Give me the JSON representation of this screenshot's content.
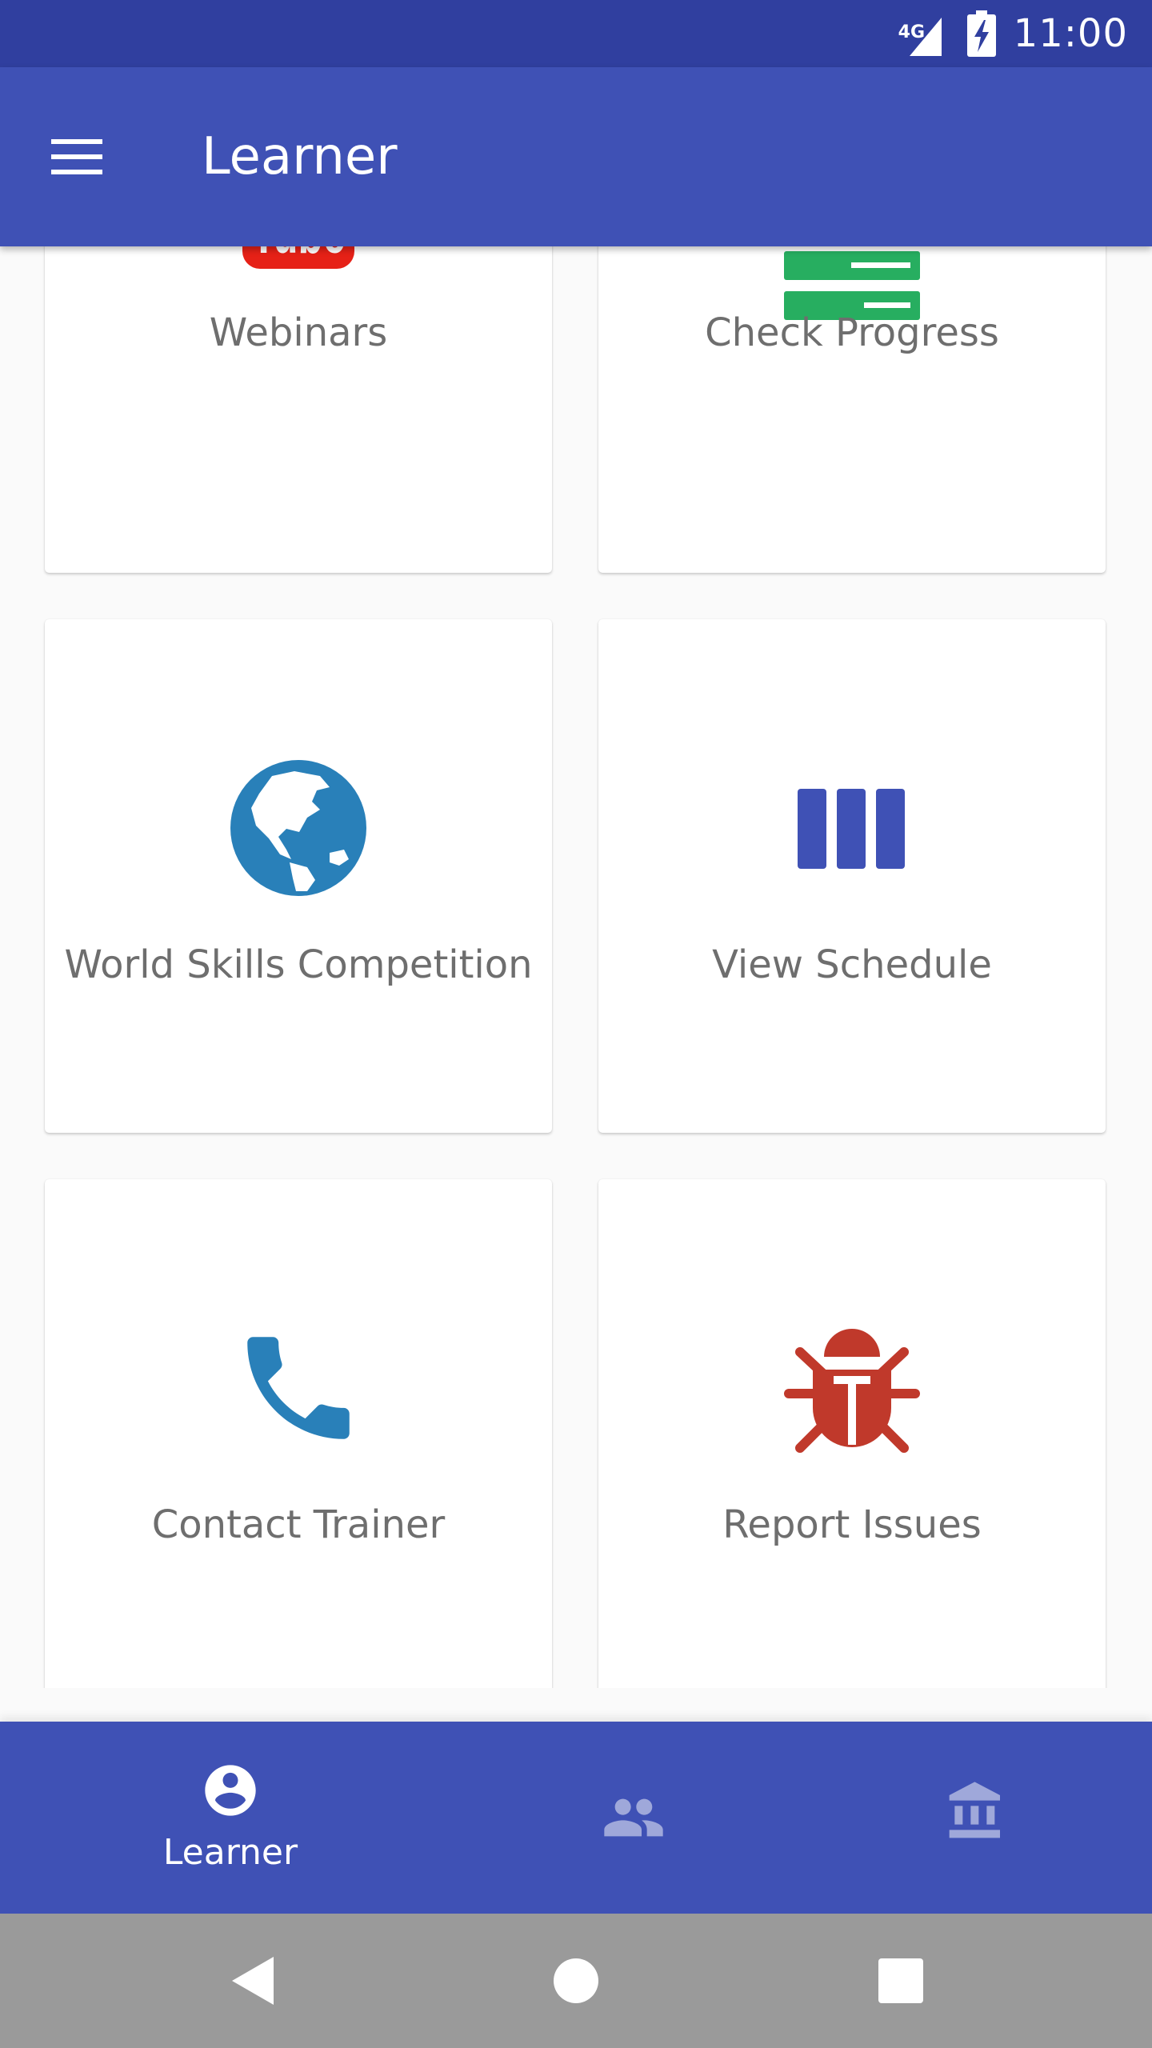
{
  "status_bar": {
    "network": "4G",
    "time": "11:00"
  },
  "app_bar": {
    "title": "Learner"
  },
  "cards": [
    {
      "label": "Webinars",
      "icon": "youtube-icon",
      "icon_text": "Tube"
    },
    {
      "label": "Check Progress",
      "icon": "progress-bars-icon"
    },
    {
      "label": "World Skills Competition",
      "icon": "globe-icon"
    },
    {
      "label": "View Schedule",
      "icon": "schedule-columns-icon"
    },
    {
      "label": "Contact Trainer",
      "icon": "phone-icon"
    },
    {
      "label": "Report Issues",
      "icon": "bug-icon"
    }
  ],
  "bottom_nav": {
    "items": [
      {
        "label": "Learner",
        "icon": "account-circle-icon",
        "selected": true
      },
      {
        "label": "",
        "icon": "people-icon",
        "selected": false
      },
      {
        "label": "",
        "icon": "institution-icon",
        "selected": false
      }
    ]
  },
  "colors": {
    "status_bar": "#303f9f",
    "primary": "#3f51b5",
    "youtube_red": "#e62117",
    "progress_green": "#27ae60",
    "globe_blue": "#2980b9",
    "phone_blue": "#2980b9",
    "bug_red": "#c0392b",
    "label_gray": "#6e6e6e"
  }
}
